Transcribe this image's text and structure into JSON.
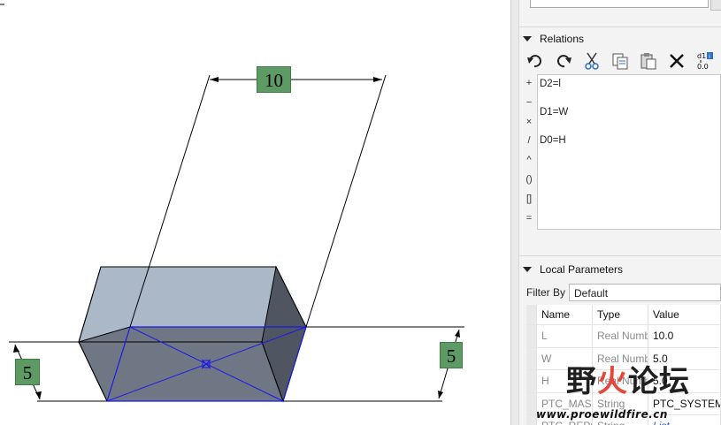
{
  "model": {
    "dim_top": "10",
    "dim_left": "5",
    "dim_right": "5"
  },
  "relations": {
    "title": "Relations",
    "toolbar": [
      "undo-icon",
      "redo-icon",
      "cut-icon",
      "copy-icon",
      "paste-icon",
      "delete-icon",
      "display-values-icon"
    ],
    "toolbar_badge": "d1 0.0",
    "operators": [
      "+",
      "−",
      "×",
      "/",
      "^",
      "()",
      "[]",
      "="
    ],
    "lines": [
      "D2=l",
      "D1=W",
      "D0=H"
    ]
  },
  "local_parameters": {
    "title": "Local Parameters",
    "filter_label": "Filter By",
    "filter_value": "Default",
    "columns": [
      "Name",
      "Type",
      "Value"
    ],
    "rows": [
      {
        "name": "L",
        "type": "Real Numb",
        "value": "10.0"
      },
      {
        "name": "W",
        "type": "Real Numb",
        "value": "5.0"
      },
      {
        "name": "H",
        "type": "Real Numb",
        "value": "5.0"
      },
      {
        "name": "PTC_MASTE",
        "type": "String",
        "value": "PTC_SYSTEM"
      },
      {
        "name": "PTC_REPOR",
        "type": "String",
        "value": "List"
      }
    ]
  },
  "watermark": {
    "chars": [
      "野",
      "火",
      "论",
      "坛"
    ],
    "url": "www.proewildfire.cn"
  }
}
